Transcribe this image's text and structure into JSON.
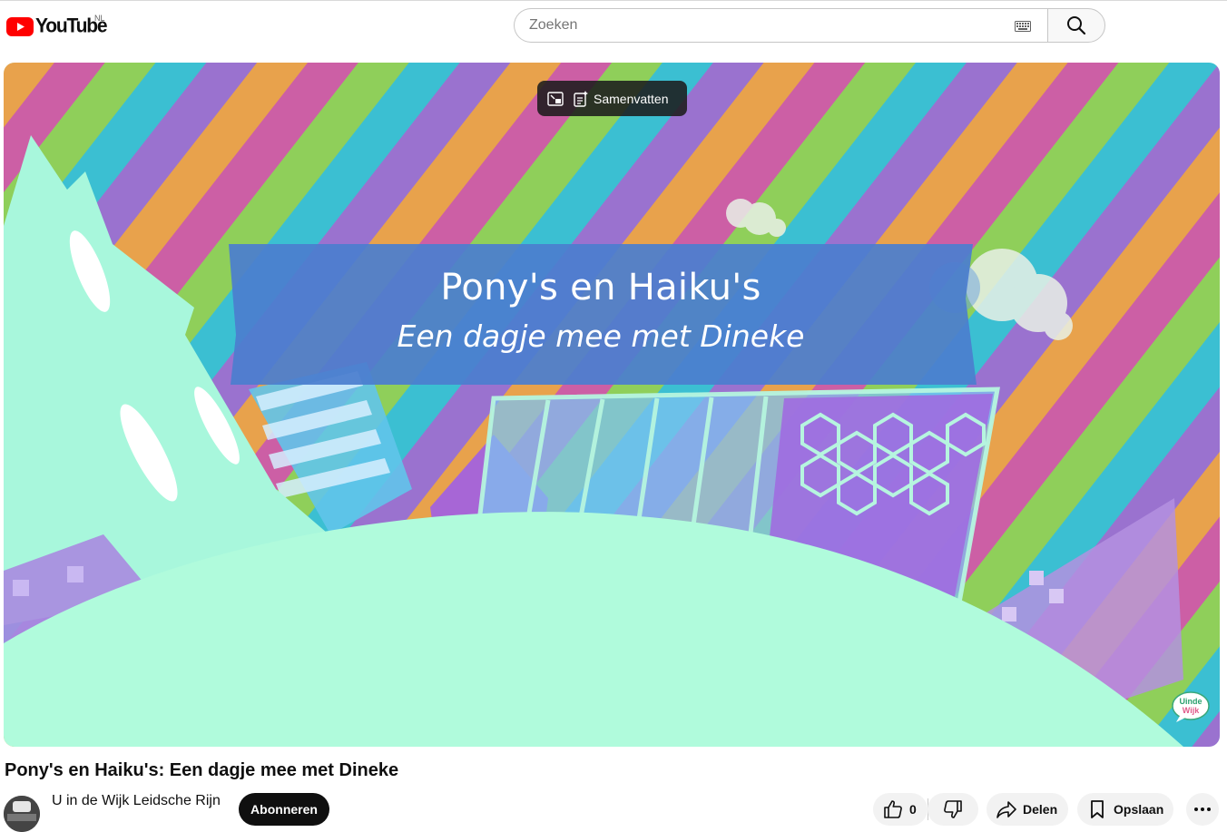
{
  "header": {
    "logo_text": "YouTube",
    "region": "NL",
    "search": {
      "placeholder": "Zoeken"
    },
    "icons": [
      "youtube-logo-icon",
      "keyboard-icon",
      "search-icon"
    ]
  },
  "player": {
    "overlay": {
      "summarize_label": "Samenvatten",
      "icons": [
        "picture-in-picture-icon",
        "summarize-icon"
      ]
    },
    "frame": {
      "title": "Pony's en Haiku's",
      "subtitle": "Een dagje mee met Dineke",
      "watermark": "U in de Wijk"
    },
    "colors": {
      "ground": "#b4f8de",
      "banner": "#4a7dd0"
    }
  },
  "video": {
    "title": "Pony's en Haiku's: Een dagje mee met Dineke",
    "channel": "U in de Wijk Leidsche Rijn",
    "subscribe_label": "Abonneren",
    "like_count": "0",
    "share_label": "Delen",
    "save_label": "Opslaan"
  }
}
